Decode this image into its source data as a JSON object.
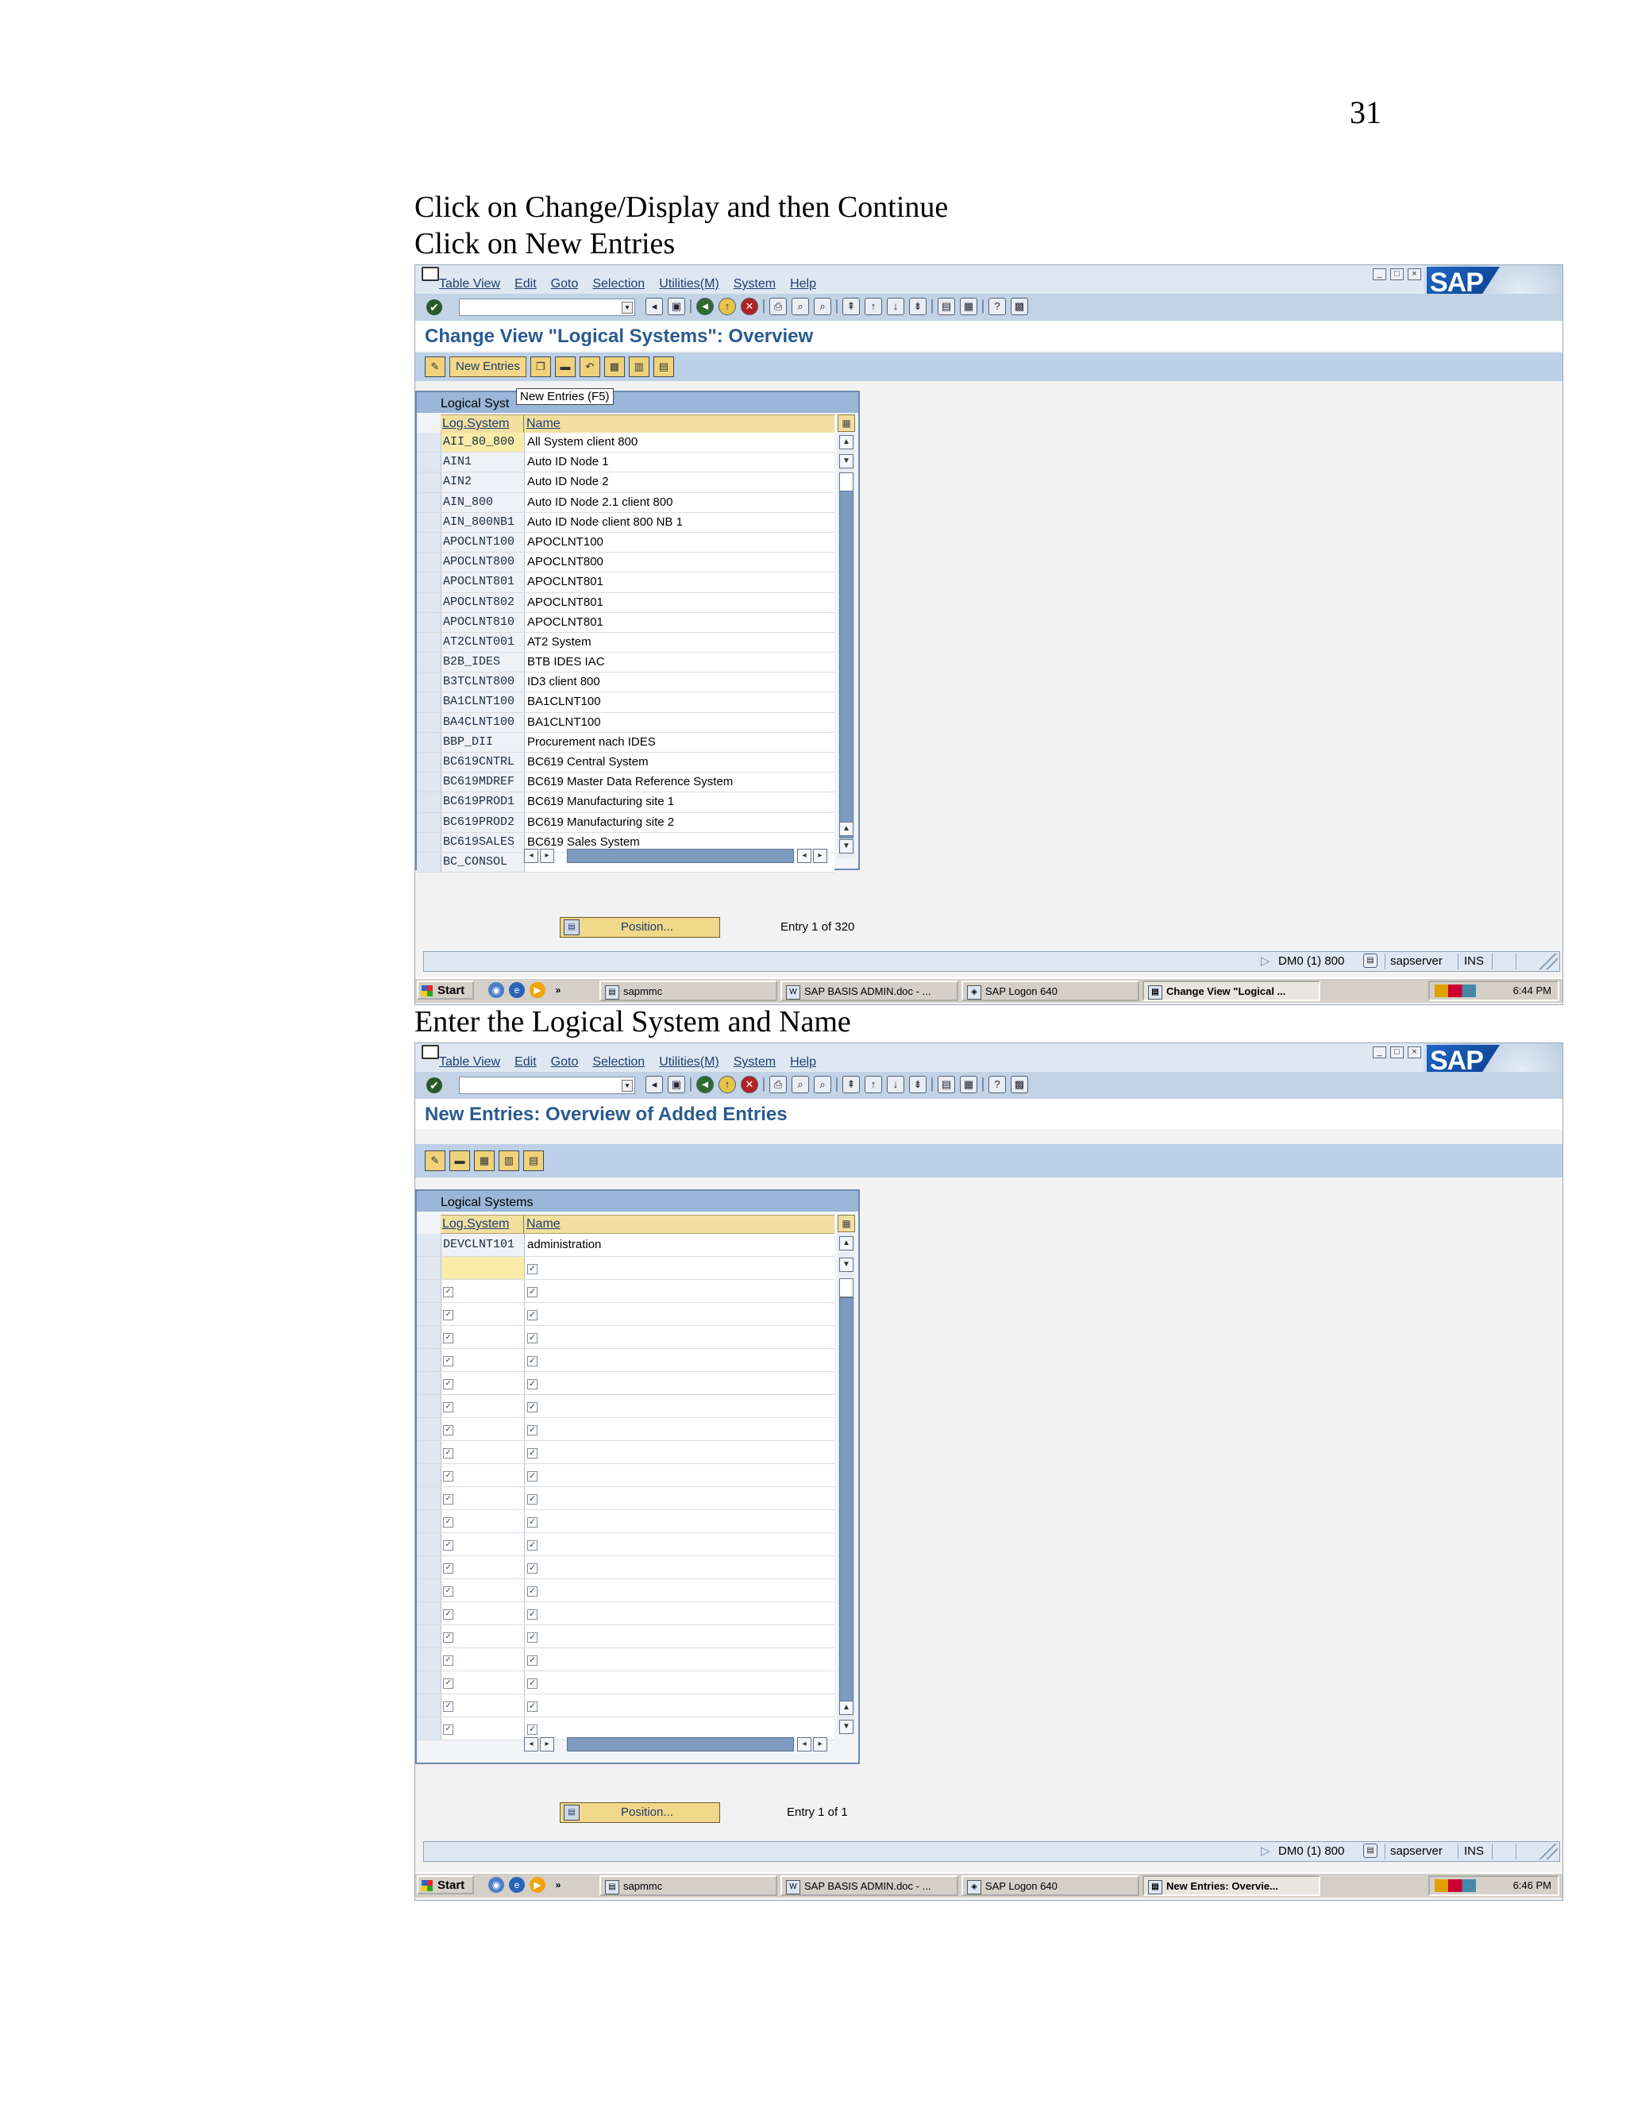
{
  "page_number": "31",
  "instructions": {
    "line1": "Click on Change/Display and then Continue",
    "line2": "Click on New Entries",
    "line3": "Enter the Logical System and Name"
  },
  "menu": [
    "Table View",
    "Edit",
    "Goto",
    "Selection",
    "Utilities(M)",
    "System",
    "Help"
  ],
  "sap_logo": "SAP",
  "window_controls": [
    "_",
    "□",
    "×"
  ],
  "screen1": {
    "title": "Change View \"Logical Systems\": Overview",
    "new_entries_label": "New Entries",
    "tooltip": "New Entries   (F5)",
    "panel_title": "Logical Syst",
    "col_logsys": "Log.System",
    "col_name": "Name",
    "rows": [
      {
        "ls": "AII_80_800",
        "name": "All System client 800"
      },
      {
        "ls": "AIN1",
        "name": "Auto ID Node 1"
      },
      {
        "ls": "AIN2",
        "name": "Auto ID Node 2"
      },
      {
        "ls": "AIN_800",
        "name": "Auto ID Node 2.1 client 800"
      },
      {
        "ls": "AIN_800NB1",
        "name": "Auto ID Node client 800 NB 1"
      },
      {
        "ls": "APOCLNT100",
        "name": "APOCLNT100"
      },
      {
        "ls": "APOCLNT800",
        "name": "APOCLNT800"
      },
      {
        "ls": "APOCLNT801",
        "name": "APOCLNT801"
      },
      {
        "ls": "APOCLNT802",
        "name": "APOCLNT801"
      },
      {
        "ls": "APOCLNT810",
        "name": "APOCLNT801"
      },
      {
        "ls": "AT2CLNT001",
        "name": "AT2 System"
      },
      {
        "ls": "B2B_IDES",
        "name": "BTB IDES IAC"
      },
      {
        "ls": "B3TCLNT800",
        "name": "ID3 client  800"
      },
      {
        "ls": "BA1CLNT100",
        "name": "BA1CLNT100"
      },
      {
        "ls": "BA4CLNT100",
        "name": "BA1CLNT100"
      },
      {
        "ls": "BBP_DII",
        "name": "Procurement nach IDES"
      },
      {
        "ls": "BC619CNTRL",
        "name": "BC619 Central System"
      },
      {
        "ls": "BC619MDREF",
        "name": "BC619 Master Data Reference System"
      },
      {
        "ls": "BC619PROD1",
        "name": "BC619 Manufacturing site 1"
      },
      {
        "ls": "BC619PROD2",
        "name": "BC619 Manufacturing site 2"
      },
      {
        "ls": "BC619SALES",
        "name": "BC619 Sales System"
      },
      {
        "ls": "BC_CONSOL",
        "name": ""
      }
    ],
    "position_label": "Position...",
    "entry_info": "Entry 1 of 320",
    "status": {
      "session": "DM0 (1) 800",
      "server": "sapserver",
      "mode": "INS"
    },
    "taskbar": {
      "start": "Start",
      "tasks": [
        "sapmmc",
        "SAP BASIS ADMIN.doc - ...",
        "SAP Logon 640",
        "Change View \"Logical ..."
      ],
      "clock": "6:44 PM"
    }
  },
  "screen2": {
    "title": "New Entries: Overview of Added Entries",
    "panel_title": "Logical Systems",
    "col_logsys": "Log.System",
    "col_name": "Name",
    "first_row": {
      "ls": "DEVCLNT101",
      "name": "administration"
    },
    "empty_rows": 21,
    "position_label": "Position...",
    "entry_info": "Entry 1 of 1",
    "status": {
      "session": "DM0 (1) 800",
      "server": "sapserver",
      "mode": "INS"
    },
    "taskbar": {
      "start": "Start",
      "tasks": [
        "sapmmc",
        "SAP BASIS ADMIN.doc - ...",
        "SAP Logon 640",
        "New Entries: Overvie..."
      ],
      "clock": "6:46 PM"
    }
  }
}
